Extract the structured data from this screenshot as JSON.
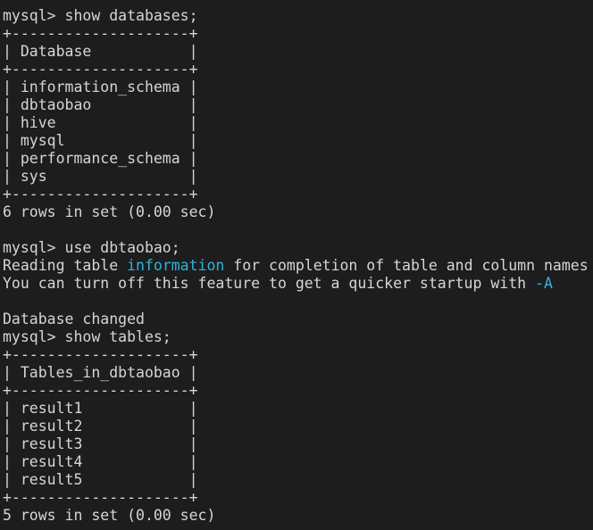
{
  "terminal": {
    "title": "mysql client session",
    "colors": {
      "background": "#1d1d1d",
      "foreground": "#d6d6d6",
      "highlight_cyan": "#2eb4dd"
    },
    "prompt": "mysql> ",
    "lines": [
      {
        "id": "l01",
        "text": "mysql> show databases;"
      },
      {
        "id": "l02",
        "text": "+--------------------+"
      },
      {
        "id": "l03",
        "text": "| Database           |"
      },
      {
        "id": "l04",
        "text": "+--------------------+"
      },
      {
        "id": "l05",
        "text": "| information_schema |"
      },
      {
        "id": "l06",
        "text": "| dbtaobao           |"
      },
      {
        "id": "l07",
        "text": "| hive               |"
      },
      {
        "id": "l08",
        "text": "| mysql              |"
      },
      {
        "id": "l09",
        "text": "| performance_schema |"
      },
      {
        "id": "l10",
        "text": "| sys                |"
      },
      {
        "id": "l11",
        "text": "+--------------------+"
      },
      {
        "id": "l12",
        "text": "6 rows in set (0.00 sec)"
      },
      {
        "id": "l13",
        "text": ""
      },
      {
        "id": "l14",
        "text": "mysql> use dbtaobao;"
      },
      {
        "id": "l15",
        "segments": [
          {
            "text": "Reading table ",
            "color": "plain"
          },
          {
            "text": "information",
            "color": "cyan"
          },
          {
            "text": " for completion of table and column names",
            "color": "plain"
          }
        ]
      },
      {
        "id": "l16",
        "segments": [
          {
            "text": "You can turn off this feature to get a quicker startup with ",
            "color": "plain"
          },
          {
            "text": "-A",
            "color": "cyan"
          }
        ]
      },
      {
        "id": "l17",
        "text": ""
      },
      {
        "id": "l18",
        "text": "Database changed"
      },
      {
        "id": "l19",
        "text": "mysql> show tables;"
      },
      {
        "id": "l20",
        "text": "+--------------------+"
      },
      {
        "id": "l21",
        "text": "| Tables_in_dbtaobao |"
      },
      {
        "id": "l22",
        "text": "+--------------------+"
      },
      {
        "id": "l23",
        "text": "| result1            |"
      },
      {
        "id": "l24",
        "text": "| result2            |"
      },
      {
        "id": "l25",
        "text": "| result3            |"
      },
      {
        "id": "l26",
        "text": "| result4            |"
      },
      {
        "id": "l27",
        "text": "| result5            |"
      },
      {
        "id": "l28",
        "text": "+--------------------+"
      },
      {
        "id": "l29",
        "text": "5 rows in set (0.00 sec)"
      }
    ],
    "queries": [
      {
        "sql": "show databases;",
        "row_count": 6,
        "duration": "0.00 sec"
      },
      {
        "sql": "use dbtaobao;",
        "result": "Database changed"
      },
      {
        "sql": "show tables;",
        "row_count": 5,
        "duration": "0.00 sec"
      }
    ],
    "databases": {
      "column_header": "Database",
      "values": [
        "information_schema",
        "dbtaobao",
        "hive",
        "mysql",
        "performance_schema",
        "sys"
      ],
      "summary": "6 rows in set (0.00 sec)"
    },
    "tables": {
      "column_header": "Tables_in_dbtaobao",
      "values": [
        "result1",
        "result2",
        "result3",
        "result4",
        "result5"
      ],
      "summary": "5 rows in set (0.00 sec)"
    }
  }
}
